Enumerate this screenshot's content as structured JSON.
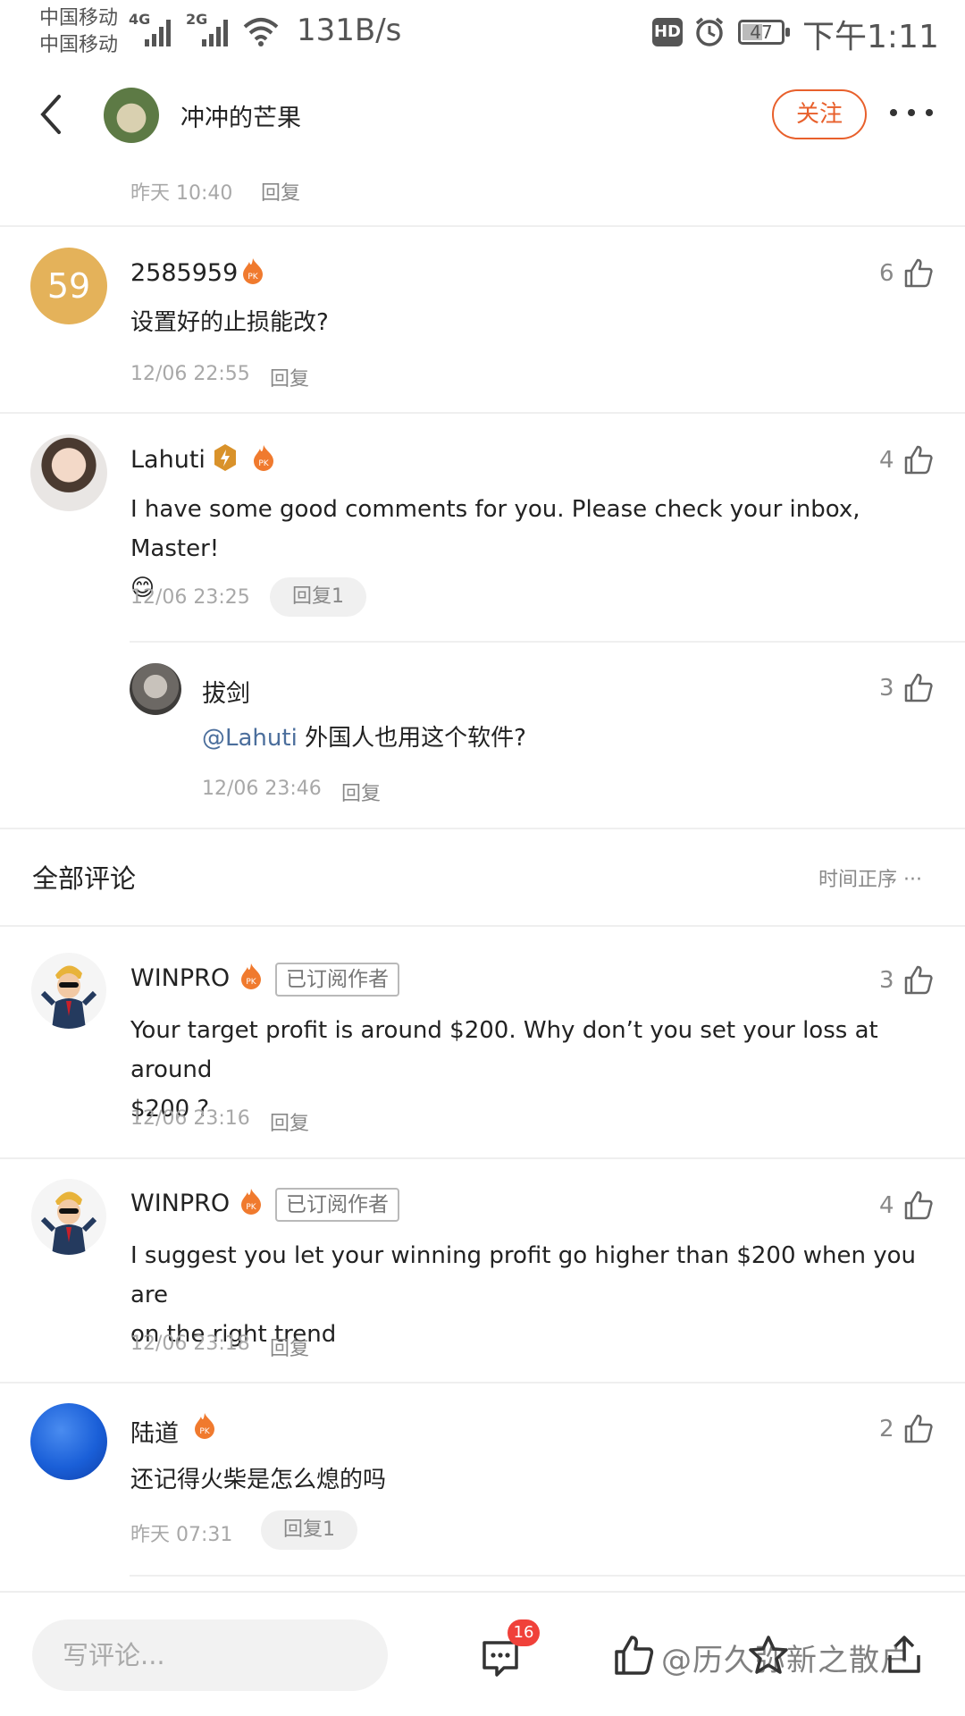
{
  "status_bar": {
    "carrier1": "中国移动",
    "carrier2": "中国移动",
    "net1": "4G",
    "net2": "2G",
    "speed": "131B/s",
    "hd": "HD",
    "battery": "47",
    "battery_level": 0.47,
    "time": "下午1:11"
  },
  "header": {
    "author": "冲冲的芒果",
    "follow_label": "关注",
    "avatar_icon": "author-avatar"
  },
  "top_meta": {
    "time": "昨天 10:40",
    "reply": "回复"
  },
  "hot_comments": [
    {
      "avatar_text": "59",
      "avatar_color": "#e4b25a",
      "name": "2585959",
      "text": "设置好的止损能改?",
      "likes": "6",
      "time": "12/06 22:55",
      "reply": "回复"
    },
    {
      "name": "Lahuti",
      "text": "I have some good comments for you. Please check your inbox, Master!",
      "emoji": "😊",
      "likes": "4",
      "time": "12/06 23:25",
      "reply": "回复1",
      "sub_reply": {
        "name": "拔剑",
        "mention": "@Lahuti",
        "text": "外国人也用这个软件?",
        "likes": "3",
        "time": "12/06 23:46",
        "reply": "回复"
      }
    }
  ],
  "all_comments": {
    "title": "全部评论",
    "sort_label": "时间正序",
    "sort_more": "···",
    "items": [
      {
        "name": "WINPRO",
        "tag": "已订阅作者",
        "text_line1": "Your target profit is around $200. Why don’t you set your loss at around",
        "text_line2": "$200 ?",
        "likes": "3",
        "time": "12/06 23:16",
        "reply": "回复"
      },
      {
        "name": "WINPRO",
        "tag": "已订阅作者",
        "text_line1": "I suggest you let your winning profit go higher than $200 when you are",
        "text_line2": "on the right trend",
        "likes": "4",
        "time": "12/06 23:18",
        "reply": "回复"
      },
      {
        "name": "陆道",
        "text_line1": "还记得火柴是怎么熄的吗",
        "likes": "2",
        "time": "昨天 07:31",
        "reply": "回复1"
      }
    ]
  },
  "bottom_bar": {
    "input_placeholder": "写评论...",
    "comment_count": "16",
    "watermark": "@历久弥新之散户"
  },
  "colors": {
    "accent": "#e8602c",
    "mention": "#4b6e9c",
    "badge_red": "#f0413a"
  }
}
